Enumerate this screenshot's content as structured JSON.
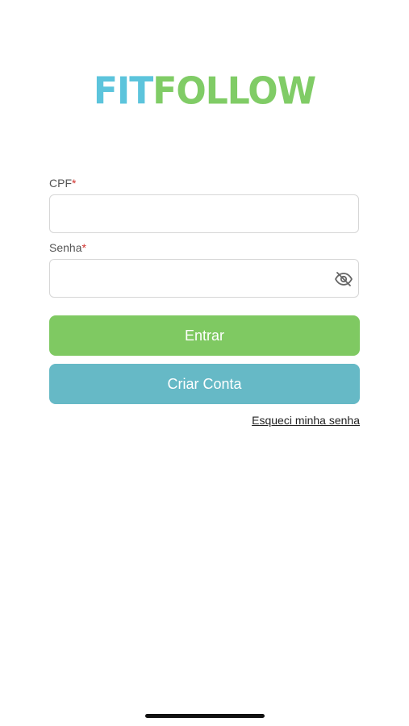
{
  "brand": {
    "part1": "FIT",
    "part2": "FOLLOW",
    "color_part1": "#5cc4dc",
    "color_part2": "#80cc66"
  },
  "form": {
    "cpf_label": "CPF",
    "password_label": "Senha",
    "required_marker": "*",
    "cpf_value": "",
    "password_value": "",
    "password_toggle_icon": "eye-off-icon"
  },
  "actions": {
    "enter_label": "Entrar",
    "create_account_label": "Criar Conta",
    "forgot_password_label": "Esqueci minha senha",
    "enter_color": "#7fc962",
    "create_color": "#66b9c6"
  }
}
